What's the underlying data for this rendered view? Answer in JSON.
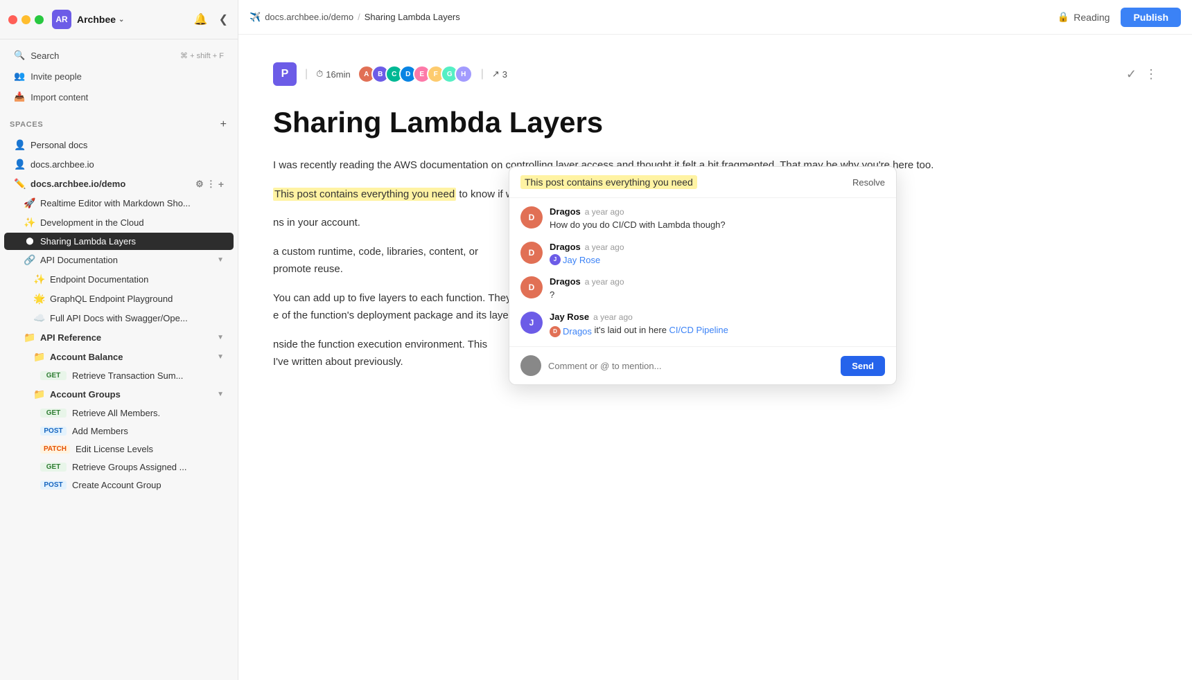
{
  "app": {
    "logo_text": "AR",
    "name": "Archbee",
    "bell_icon": "🔔",
    "collapse_icon": "❮"
  },
  "sidebar": {
    "search_label": "Search",
    "search_shortcut": "⌘ + shift + F",
    "invite_label": "Invite people",
    "import_label": "Import content",
    "spaces_label": "SPACES",
    "spaces": [
      {
        "id": "personal",
        "label": "Personal docs",
        "icon": "👤",
        "indent": 0
      },
      {
        "id": "archbee",
        "label": "docs.archbee.io",
        "icon": "👤",
        "indent": 0
      },
      {
        "id": "demo",
        "label": "docs.archbee.io/demo",
        "icon": "✏️",
        "indent": 0,
        "bold": true
      },
      {
        "id": "realtime",
        "label": "Realtime Editor with Markdown Sho...",
        "icon": "🚀",
        "indent": 1
      },
      {
        "id": "devcloud",
        "label": "Development in the Cloud",
        "icon": "✨",
        "indent": 1
      },
      {
        "id": "sharing",
        "label": "Sharing Lambda Layers",
        "icon": "⬤",
        "indent": 1,
        "active": true
      },
      {
        "id": "apidoc",
        "label": "API Documentation",
        "icon": "🔗",
        "indent": 1,
        "chevron": "▼"
      },
      {
        "id": "endpoint",
        "label": "Endpoint Documentation",
        "icon": "✨",
        "indent": 2
      },
      {
        "id": "graphql",
        "label": "GraphQL Endpoint Playground",
        "icon": "🌟",
        "indent": 2
      },
      {
        "id": "swagger",
        "label": "Full API Docs with Swagger/Ope...",
        "icon": "☁️",
        "indent": 2
      },
      {
        "id": "apiref",
        "label": "API Reference",
        "icon": "📁",
        "indent": 1,
        "chevron": "▼"
      },
      {
        "id": "accbalance",
        "label": "Account Balance",
        "icon": "📁",
        "indent": 2,
        "chevron": "▼"
      },
      {
        "id": "retrieve_trans",
        "label": "Retrieve Transaction Sum...",
        "method": "GET",
        "indent": 3
      },
      {
        "id": "accgroups",
        "label": "Account Groups",
        "icon": "📁",
        "indent": 2,
        "chevron": "▼"
      },
      {
        "id": "retrieve_all",
        "label": "Retrieve All Members.",
        "method": "GET",
        "indent": 3
      },
      {
        "id": "add_members",
        "label": "Add Members",
        "method": "POST",
        "indent": 3
      },
      {
        "id": "edit_license",
        "label": "Edit License Levels",
        "method": "PATCH",
        "indent": 3
      },
      {
        "id": "retrieve_groups",
        "label": "Retrieve Groups Assigned ...",
        "method": "GET",
        "indent": 3
      },
      {
        "id": "create_group",
        "label": "Create Account Group",
        "method": "POST",
        "indent": 3
      }
    ]
  },
  "topbar": {
    "logo_icon": "✈️",
    "site": "docs.archbee.io/demo",
    "separator": "/",
    "current_page": "Sharing Lambda Layers",
    "reading_label": "Reading",
    "publish_label": "Publish"
  },
  "doc": {
    "initial": "P",
    "read_time": "16min",
    "avatar_colors": [
      "#e17055",
      "#6c5ce7",
      "#00b894",
      "#0984e3",
      "#fd79a8",
      "#fdcb6e",
      "#55efc4",
      "#a29bfe"
    ],
    "avatar_labels": [
      "A",
      "B",
      "C",
      "D",
      "E",
      "F",
      "G",
      "H"
    ],
    "refs_count": "3",
    "title": "Sharing Lambda Layers",
    "body_p1": "I was recently reading the AWS documentation on controlling layer access and thought it felt a bit fragmented. That may be why you're here too.",
    "highlighted_text": "This post contains everything you need",
    "body_p2_before": " to know if want to share a layer with another account, an organization, or publicly.",
    "body_p3": "ns in your account.",
    "body_p4a": "a custom runtime, code, libraries, content, or",
    "body_p4b": "promote reuse.",
    "body_p5a": "You can add up to five layers to each function. They",
    "body_p5b": "e of the function's deployment package and its layers",
    "body_p6": "nside the function execution environment. This",
    "body_p6b": "I've written about previously."
  },
  "comment_popup": {
    "highlighted_text": "This post contains everything you need",
    "resolve_label": "Resolve",
    "comments": [
      {
        "id": 1,
        "author": "Dragos",
        "time": "a year ago",
        "text": "How do you do CI/CD with Lambda though?",
        "avatar_color": "#e17055",
        "avatar_label": "D"
      },
      {
        "id": 2,
        "author": "Dragos",
        "time": "a year ago",
        "text": "",
        "mention": "Jay Rose",
        "mention_link": "#",
        "avatar_color": "#e17055",
        "avatar_label": "D"
      },
      {
        "id": 3,
        "author": "Dragos",
        "time": "a year ago",
        "text": "?",
        "avatar_color": "#e17055",
        "avatar_label": "D"
      },
      {
        "id": 4,
        "author": "Jay Rose",
        "time": "a year ago",
        "text": "it's laid out in here",
        "mention": "Dragos",
        "doc_link_text": "CI/CD Pipeline",
        "doc_link": "#",
        "avatar_color": "#6c5ce7",
        "avatar_label": "J"
      }
    ],
    "comment_placeholder": "Comment or @ to mention...",
    "send_label": "Send"
  }
}
